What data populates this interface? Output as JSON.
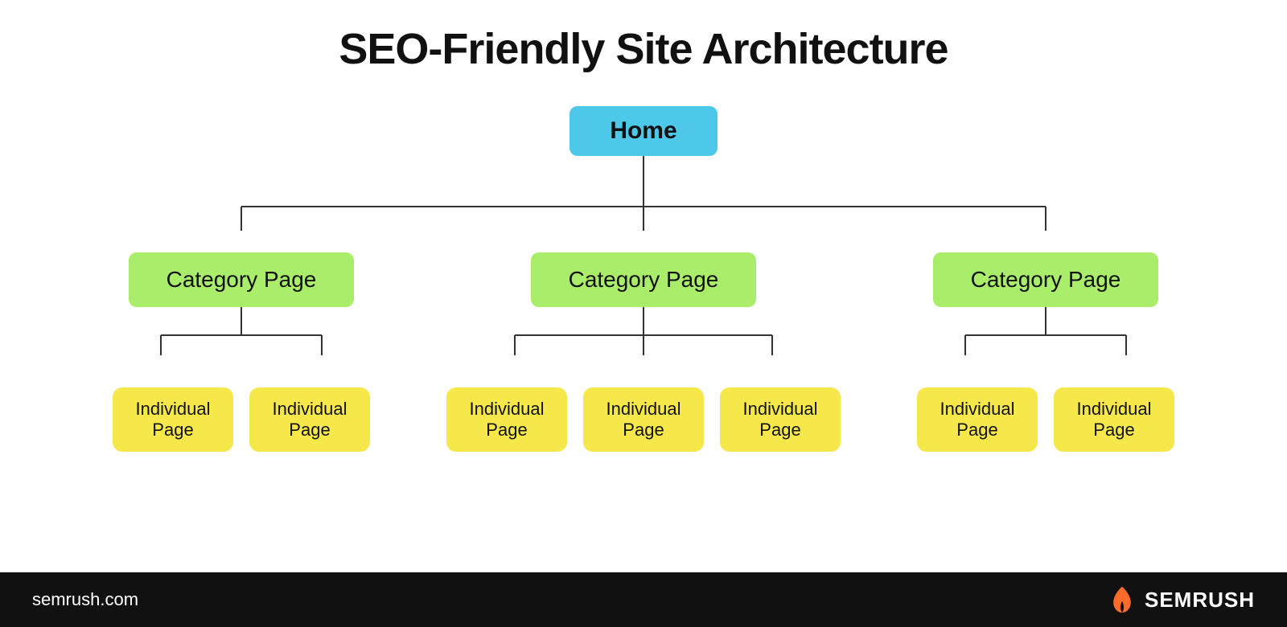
{
  "title": "SEO-Friendly Site Architecture",
  "nodes": {
    "home": "Home",
    "category": "Category Page",
    "individual": "Individual Page"
  },
  "columns": [
    {
      "category": "Category Page",
      "individuals": [
        "Individual Page",
        "Individual Page"
      ]
    },
    {
      "category": "Category Page",
      "individuals": [
        "Individual Page",
        "Individual Page",
        "Individual Page"
      ]
    },
    {
      "category": "Category Page",
      "individuals": [
        "Individual Page",
        "Individual Page"
      ]
    }
  ],
  "footer": {
    "url": "semrush.com",
    "brand": "SEMRUSH"
  },
  "colors": {
    "home": "#4DC8E8",
    "category": "#AAED6A",
    "individual": "#F6E84B",
    "footer_bg": "#111111",
    "connector": "#333333"
  }
}
